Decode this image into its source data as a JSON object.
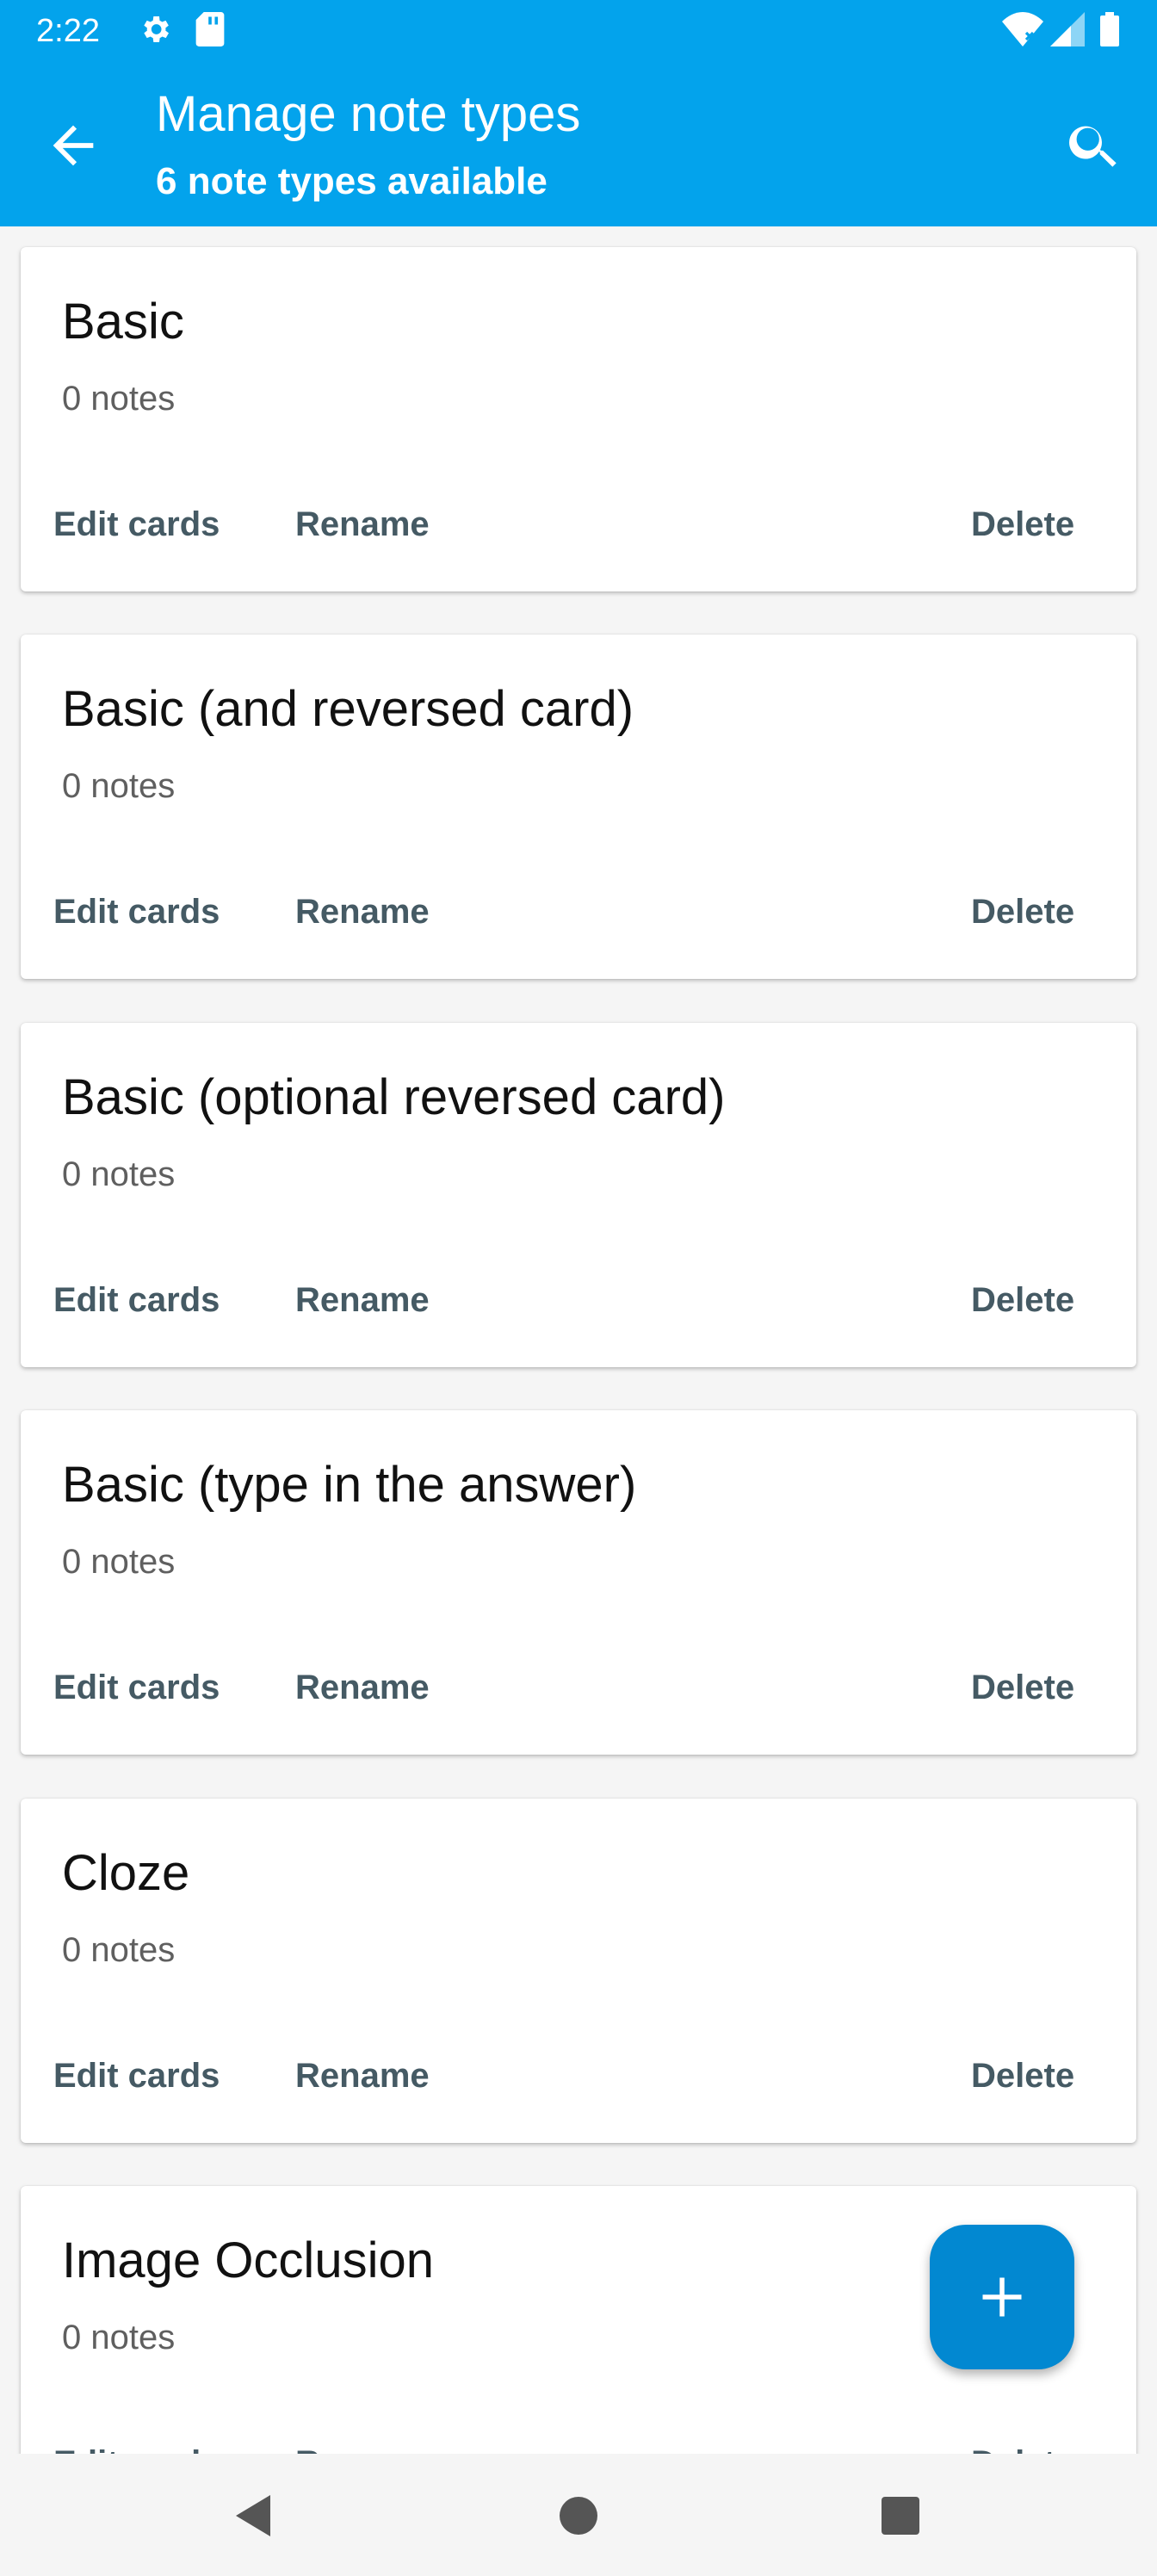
{
  "status_bar": {
    "time": "2:22",
    "icons": [
      "gear-icon",
      "sd-card-icon",
      "wifi-icon",
      "signal-icon",
      "battery-icon"
    ]
  },
  "toolbar": {
    "back_icon": "arrow-back-icon",
    "title": "Manage note types",
    "subtitle": "6 note types available",
    "search_icon": "search-icon",
    "color": "#03a3ec"
  },
  "note_types": [
    {
      "name": "Basic",
      "count": "0 notes",
      "edit_label": "Edit cards",
      "rename_label": "Rename",
      "delete_label": "Delete"
    },
    {
      "name": "Basic (and reversed card)",
      "count": "0 notes",
      "edit_label": "Edit cards",
      "rename_label": "Rename",
      "delete_label": "Delete"
    },
    {
      "name": "Basic (optional reversed card)",
      "count": "0 notes",
      "edit_label": "Edit cards",
      "rename_label": "Rename",
      "delete_label": "Delete"
    },
    {
      "name": "Basic (type in the answer)",
      "count": "0 notes",
      "edit_label": "Edit cards",
      "rename_label": "Rename",
      "delete_label": "Delete"
    },
    {
      "name": "Cloze",
      "count": "0 notes",
      "edit_label": "Edit cards",
      "rename_label": "Rename",
      "delete_label": "Delete"
    },
    {
      "name": "Image Occlusion",
      "count": "0 notes",
      "edit_label": "Edit cards",
      "rename_label": "Rename",
      "delete_label": "Delete"
    }
  ],
  "fab": {
    "icon": "add-icon",
    "color": "#0288d1"
  },
  "navigation": {
    "icons": [
      "back-triangle-icon",
      "home-circle-icon",
      "recents-square-icon"
    ]
  }
}
